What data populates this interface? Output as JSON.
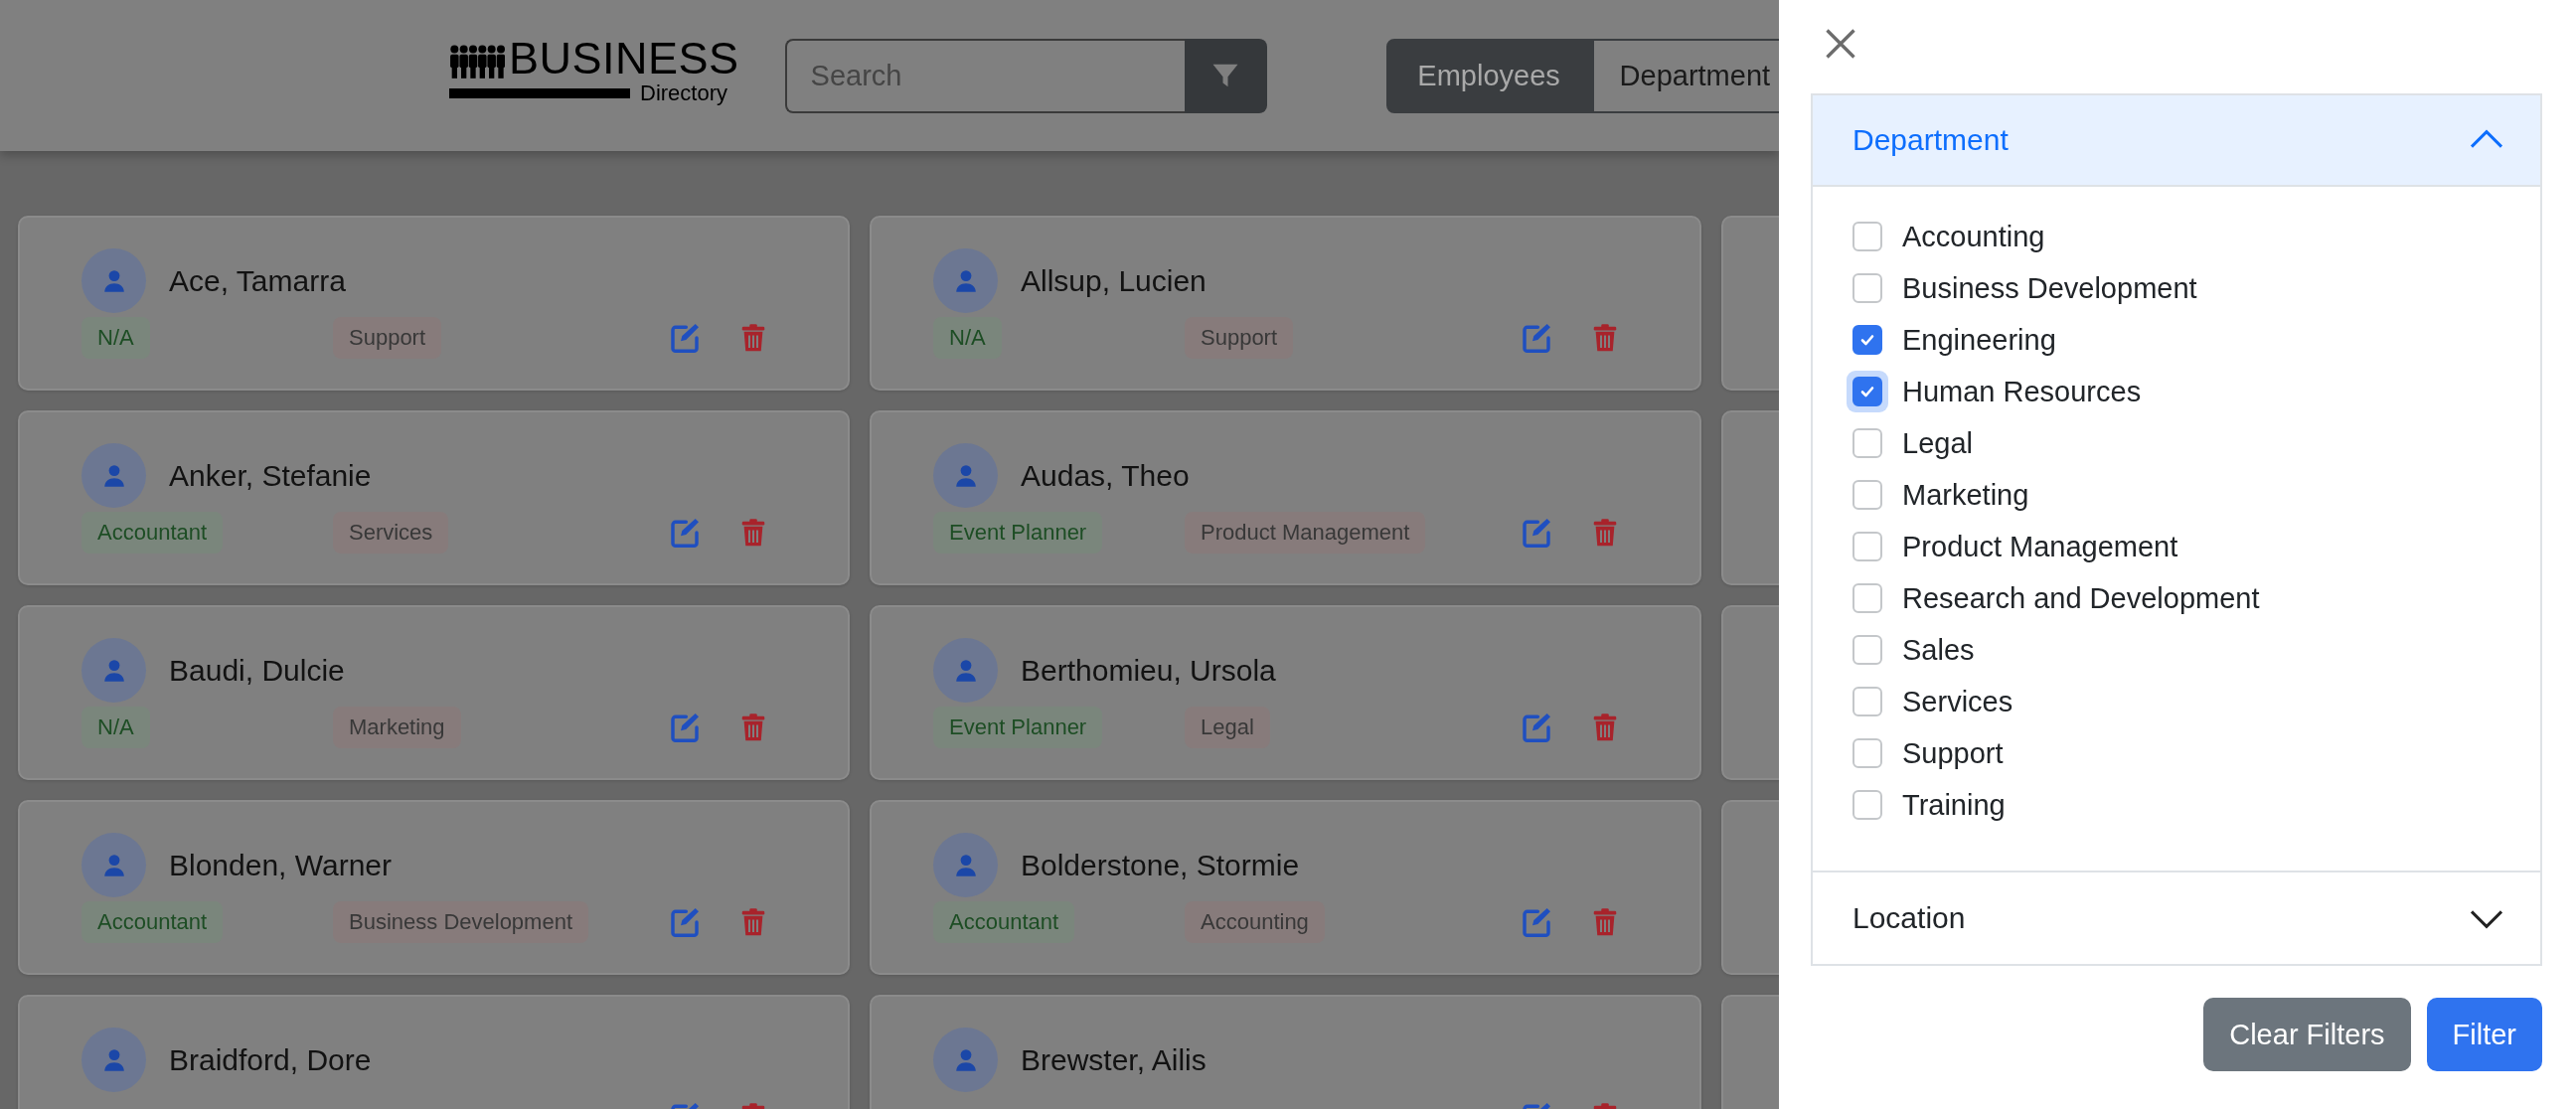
{
  "logo": {
    "title": "BUSINESS",
    "subtitle": "Directory"
  },
  "search": {
    "placeholder": "Search"
  },
  "nav_tabs": [
    {
      "label": "Employees",
      "selected": true
    },
    {
      "label": "Department",
      "selected": false
    }
  ],
  "employees": [
    {
      "name": "Ace, Tamarra",
      "role": "N/A",
      "department": "Support"
    },
    {
      "name": "Allsup, Lucien",
      "role": "N/A",
      "department": "Support"
    },
    {
      "name": "Anker, Stefanie",
      "role": "Accountant",
      "department": "Services"
    },
    {
      "name": "Audas, Theo",
      "role": "Event Planner",
      "department": "Product Management"
    },
    {
      "name": "Baudi, Dulcie",
      "role": "N/A",
      "department": "Marketing"
    },
    {
      "name": "Berthomieu, Ursola",
      "role": "Event Planner",
      "department": "Legal"
    },
    {
      "name": "Blonden, Warner",
      "role": "Accountant",
      "department": "Business Development"
    },
    {
      "name": "Bolderstone, Stormie",
      "role": "Accountant",
      "department": "Accounting"
    },
    {
      "name": "Braidford, Dore"
    },
    {
      "name": "Brewster, Ailis"
    }
  ],
  "filter_panel": {
    "sections": [
      {
        "title": "Department",
        "expanded": true,
        "options": [
          {
            "label": "Accounting",
            "checked": false,
            "focused": false
          },
          {
            "label": "Business Development",
            "checked": false,
            "focused": false
          },
          {
            "label": "Engineering",
            "checked": true,
            "focused": false
          },
          {
            "label": "Human Resources",
            "checked": true,
            "focused": true
          },
          {
            "label": "Legal",
            "checked": false,
            "focused": false
          },
          {
            "label": "Marketing",
            "checked": false,
            "focused": false
          },
          {
            "label": "Product Management",
            "checked": false,
            "focused": false
          },
          {
            "label": "Research and Development",
            "checked": false,
            "focused": false
          },
          {
            "label": "Sales",
            "checked": false,
            "focused": false
          },
          {
            "label": "Services",
            "checked": false,
            "focused": false
          },
          {
            "label": "Support",
            "checked": false,
            "focused": false
          },
          {
            "label": "Training",
            "checked": false,
            "focused": false
          }
        ]
      },
      {
        "title": "Location",
        "expanded": false
      }
    ],
    "buttons": [
      {
        "label": "Clear Filters",
        "kind": "secondary"
      },
      {
        "label": "Filter",
        "kind": "primary"
      }
    ]
  }
}
